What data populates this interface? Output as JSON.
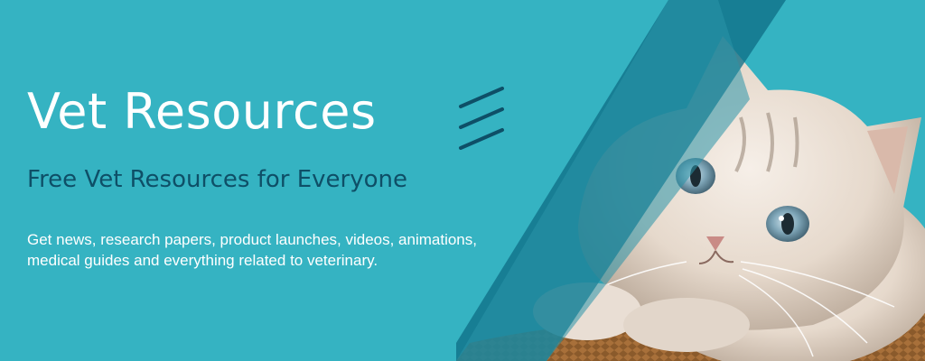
{
  "hero": {
    "title": "Vet Resources",
    "subtitle": "Free Vet Resources for Everyone",
    "description_line1": "Get news, research papers, product launches, videos, animations,",
    "description_line2": "medical guides and everything related to veterinary."
  },
  "colors": {
    "background": "#35b3c2",
    "band": "#0f6f86",
    "subtitle": "#0e4f67",
    "text": "#ffffff"
  },
  "icons": {
    "decoration": "triple-diagonal-lines-icon",
    "image": "kitten-photo"
  }
}
